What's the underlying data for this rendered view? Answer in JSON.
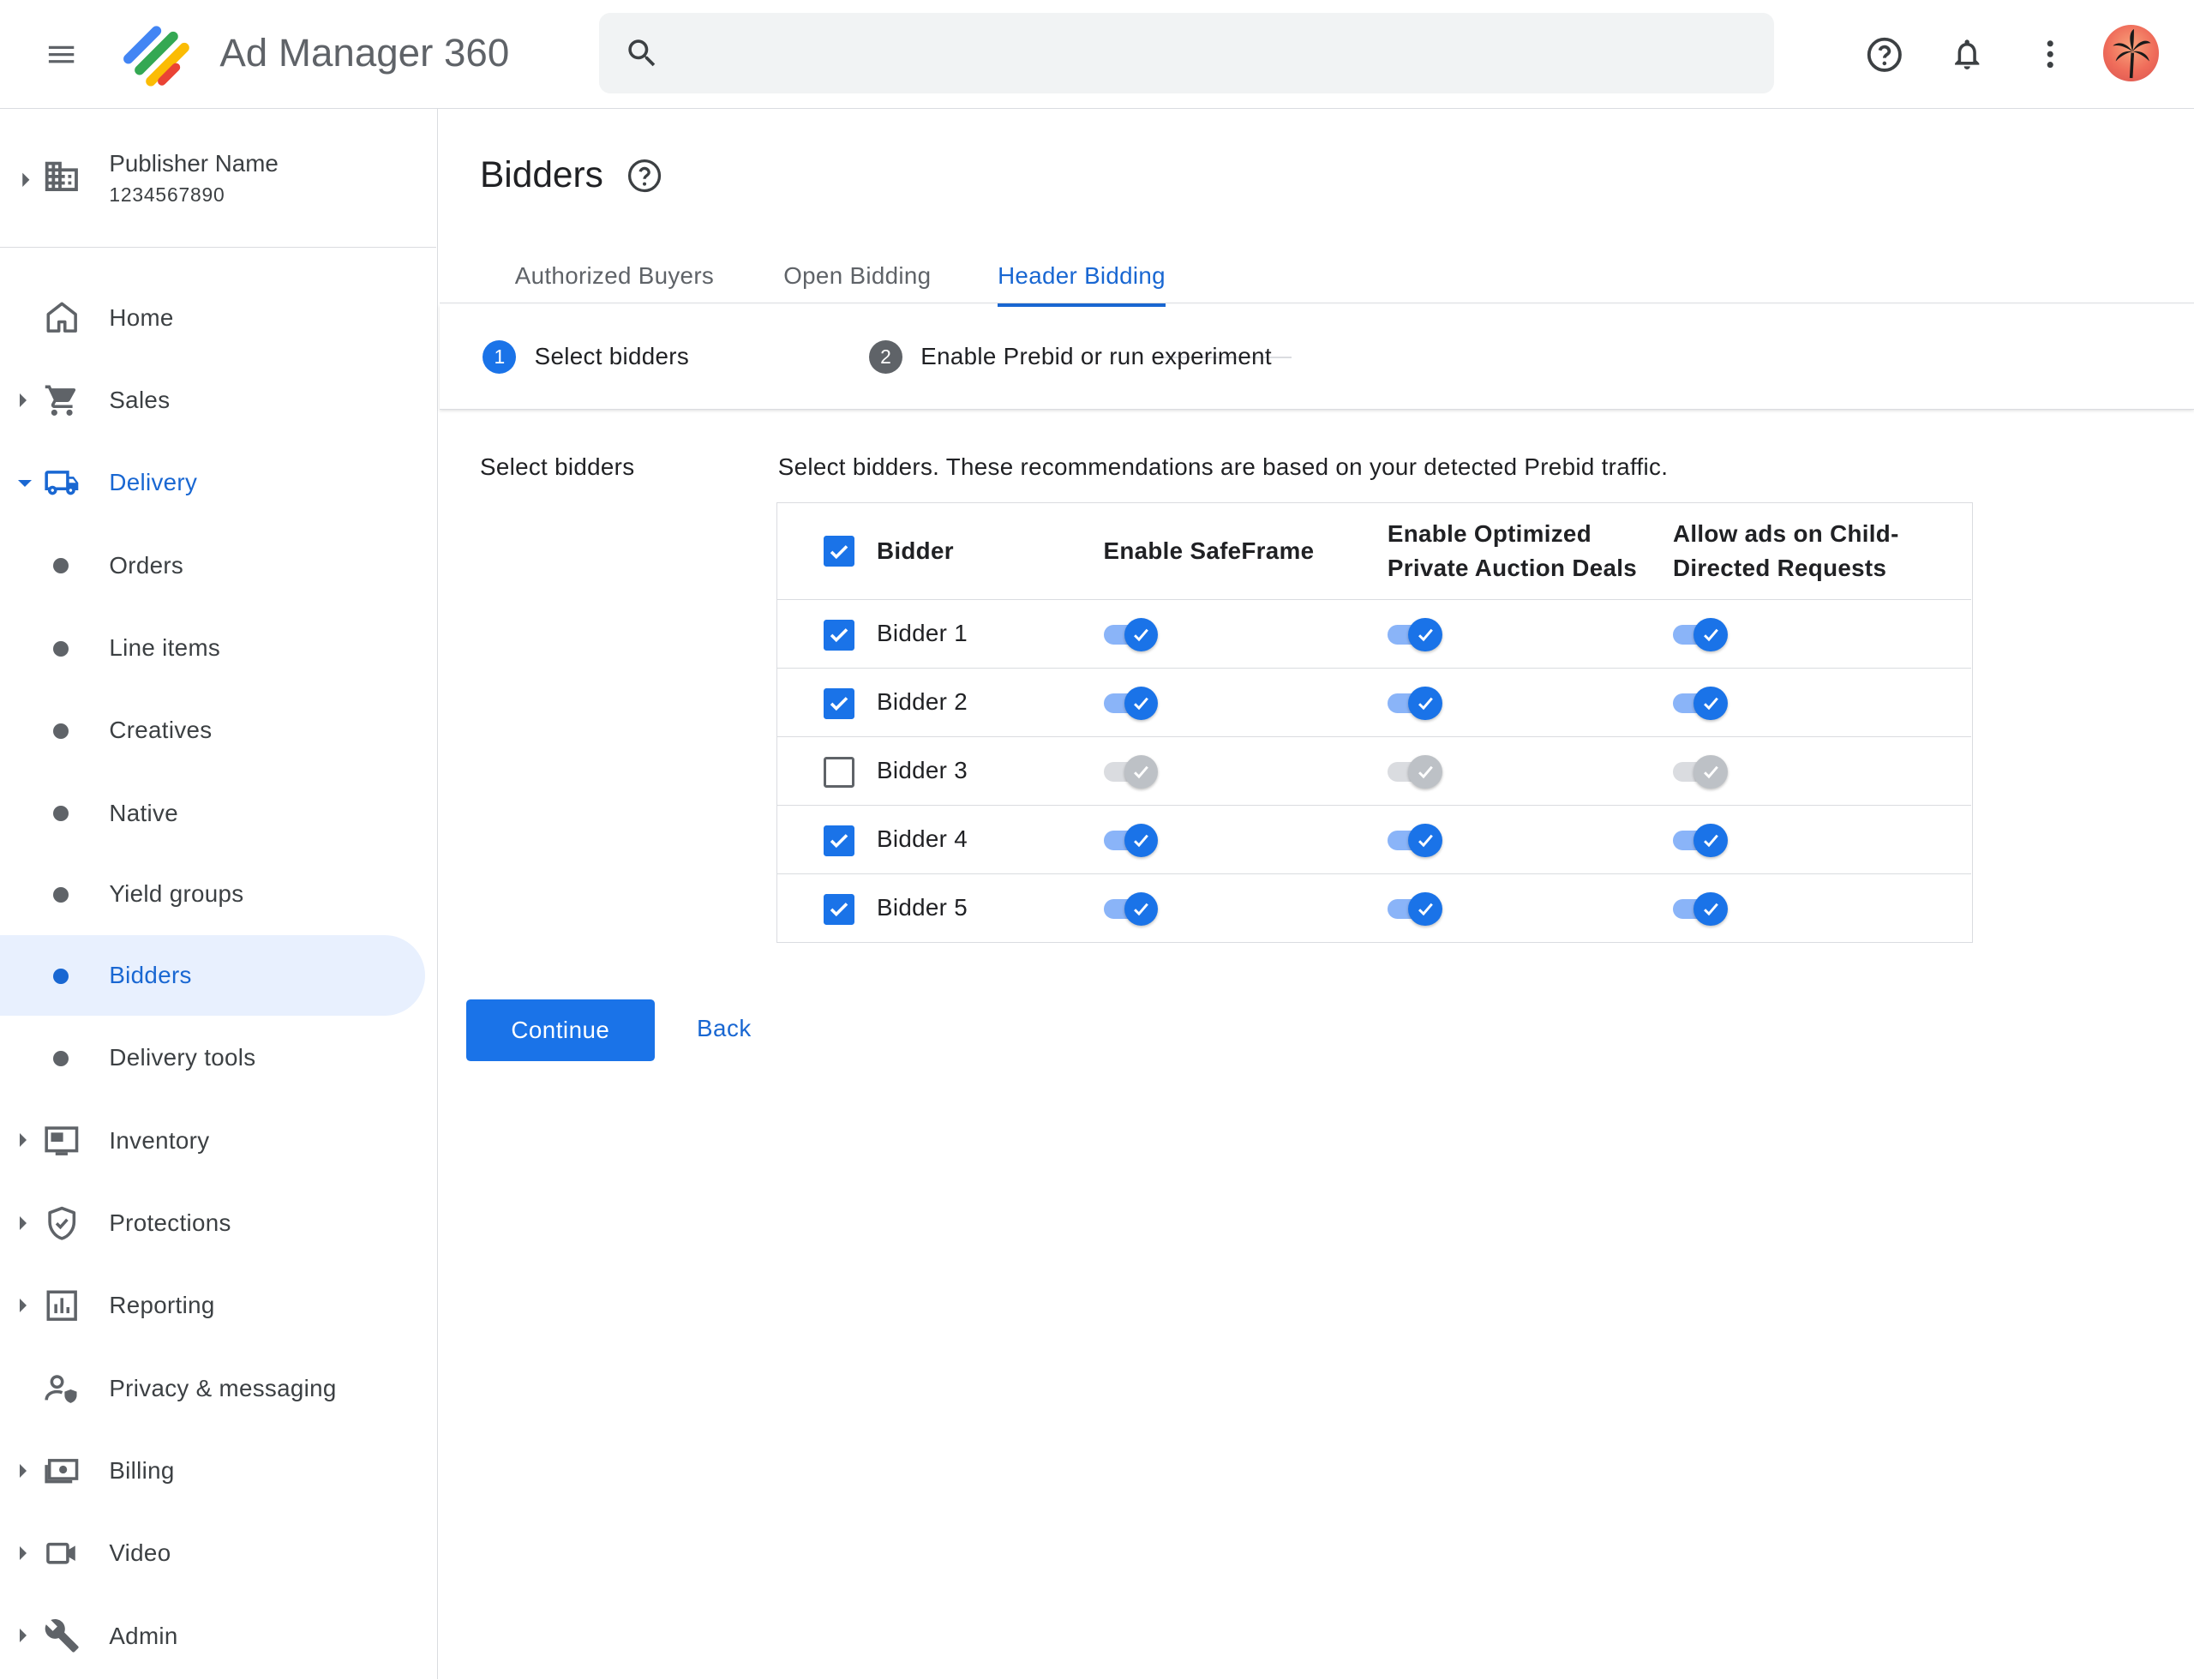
{
  "app": {
    "title": "Ad Manager 360"
  },
  "topbar": {
    "search_placeholder": ""
  },
  "publisher": {
    "name": "Publisher Name",
    "id": "1234567890"
  },
  "nav": [
    {
      "label": "Home"
    },
    {
      "label": "Sales"
    },
    {
      "label": "Delivery"
    },
    {
      "label": "Orders"
    },
    {
      "label": "Line items"
    },
    {
      "label": "Creatives"
    },
    {
      "label": "Native"
    },
    {
      "label": "Yield groups"
    },
    {
      "label": "Bidders"
    },
    {
      "label": "Delivery tools"
    },
    {
      "label": "Inventory"
    },
    {
      "label": "Protections"
    },
    {
      "label": "Reporting"
    },
    {
      "label": "Privacy & messaging"
    },
    {
      "label": "Billing"
    },
    {
      "label": "Video"
    },
    {
      "label": "Admin"
    }
  ],
  "page": {
    "title": "Bidders",
    "tabs": [
      "Authorized Buyers",
      "Open Bidding",
      "Header Bidding"
    ],
    "active_tab": "Header Bidding",
    "steps": [
      {
        "number": "1",
        "label": "Select bidders"
      },
      {
        "number": "2",
        "label": "Enable Prebid or run experiment"
      }
    ],
    "section_label": "Select bidders",
    "section_description": "Select bidders. These recommendations are based on your detected Prebid traffic."
  },
  "table": {
    "columns": [
      "Bidder",
      "Enable SafeFrame",
      "Enable Optimized Private Auction Deals",
      "Allow ads on Child-Directed Requests"
    ],
    "column_lines": [
      [
        "Bidder"
      ],
      [
        "Enable SafeFrame"
      ],
      [
        "Enable Optimized",
        "Private Auction Deals"
      ],
      [
        "Allow ads on Child-",
        "Directed Requests"
      ]
    ],
    "select_all_checked": true,
    "rows": [
      {
        "name": "Bidder 1",
        "selected": true,
        "safeframe": true,
        "optimized_deals": true,
        "child_directed": true
      },
      {
        "name": "Bidder 2",
        "selected": true,
        "safeframe": true,
        "optimized_deals": true,
        "child_directed": true
      },
      {
        "name": "Bidder 3",
        "selected": false,
        "safeframe": false,
        "optimized_deals": false,
        "child_directed": false
      },
      {
        "name": "Bidder 4",
        "selected": true,
        "safeframe": true,
        "optimized_deals": true,
        "child_directed": true
      },
      {
        "name": "Bidder 5",
        "selected": true,
        "safeframe": true,
        "optimized_deals": true,
        "child_directed": true
      }
    ]
  },
  "actions": {
    "continue_label": "Continue",
    "back_label": "Back"
  },
  "colors": {
    "accent": "#1a73e8",
    "active_nav_bg": "#e8f0fe",
    "link": "#1967d2"
  }
}
